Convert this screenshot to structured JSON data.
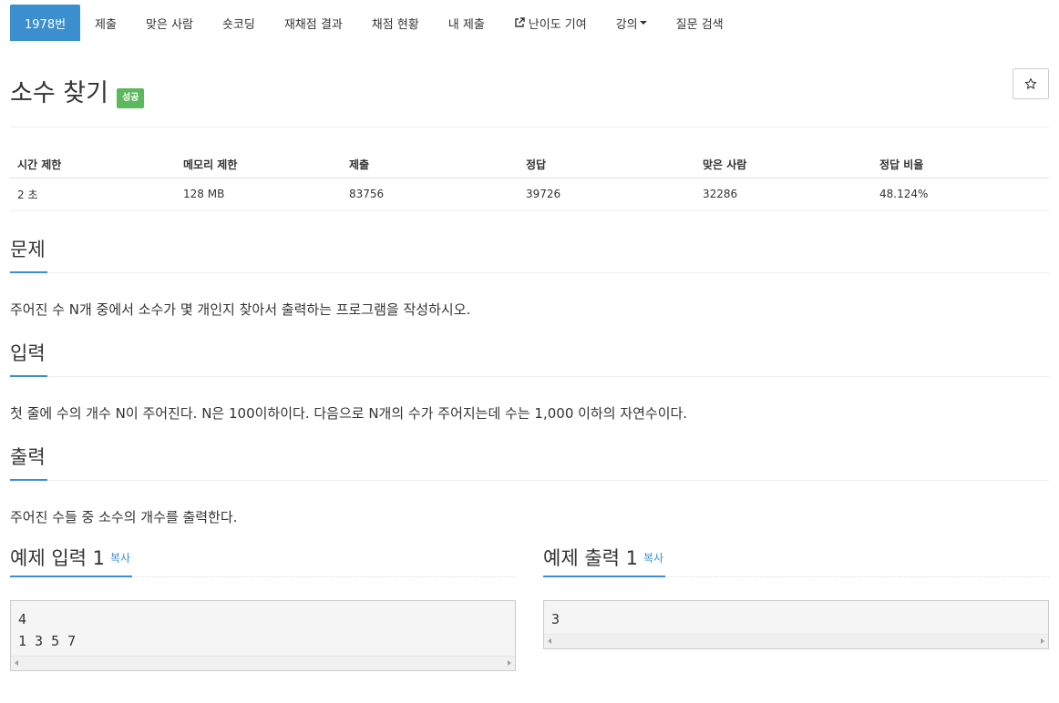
{
  "nav": {
    "items": [
      {
        "label": "1978번",
        "active": true
      },
      {
        "label": "제출"
      },
      {
        "label": "맞은 사람"
      },
      {
        "label": "숏코딩"
      },
      {
        "label": "재채점 결과"
      },
      {
        "label": "채점 현황"
      },
      {
        "label": "내 제출"
      },
      {
        "label": "난이도 기여",
        "icon": "external-link-icon"
      },
      {
        "label": "강의",
        "icon": "caret-down-icon"
      },
      {
        "label": "질문 검색"
      }
    ]
  },
  "problem": {
    "title": "소수 찾기",
    "badge": "성공",
    "star_icon": "star-outline-icon"
  },
  "info_table": {
    "headers": [
      "시간 제한",
      "메모리 제한",
      "제출",
      "정답",
      "맞은 사람",
      "정답 비율"
    ],
    "row": [
      "2 초",
      "128 MB",
      "83756",
      "39726",
      "32286",
      "48.124%"
    ]
  },
  "sections": {
    "problem": {
      "heading": "문제",
      "text": "주어진 수 N개 중에서 소수가 몇 개인지 찾아서 출력하는 프로그램을 작성하시오."
    },
    "input": {
      "heading": "입력",
      "text": "첫 줄에 수의 개수 N이 주어진다. N은 100이하이다. 다음으로 N개의 수가 주어지는데 수는 1,000 이하의 자연수이다."
    },
    "output": {
      "heading": "출력",
      "text": "주어진 수들 중 소수의 개수를 출력한다."
    }
  },
  "samples": {
    "input": {
      "heading": "예제 입력 1",
      "copy_label": "복사",
      "content": "4\n1 3 5 7"
    },
    "output": {
      "heading": "예제 출력 1",
      "copy_label": "복사",
      "content": "3"
    }
  },
  "colors": {
    "accent": "#3c8fcf",
    "success": "#5cb85c"
  }
}
